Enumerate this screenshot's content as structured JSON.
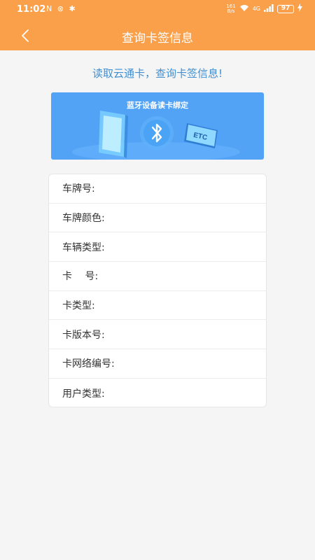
{
  "status": {
    "time": "11:02",
    "left_icons": "N ⊗ ✱",
    "network": "4G",
    "speed_top": "161",
    "speed_bottom": "B/s",
    "battery": "97"
  },
  "header": {
    "title": "查询卡签信息"
  },
  "instruction": "读取云通卡，查询卡签信息!",
  "banner": {
    "title": "蓝牙设备读卡绑定",
    "card_text": "ETC"
  },
  "colors": {
    "header": "#fba04a",
    "banner": "#52a2f5",
    "instruction": "#3f8fd2"
  },
  "fields": [
    {
      "label": "车牌号:",
      "value": ""
    },
    {
      "label": "车牌颜色:",
      "value": ""
    },
    {
      "label": "车辆类型:",
      "value": ""
    },
    {
      "label": "卡　 号:",
      "value": ""
    },
    {
      "label": "卡类型:",
      "value": ""
    },
    {
      "label": "卡版本号:",
      "value": ""
    },
    {
      "label": "卡网络编号:",
      "value": ""
    },
    {
      "label": "用户类型:",
      "value": ""
    }
  ]
}
